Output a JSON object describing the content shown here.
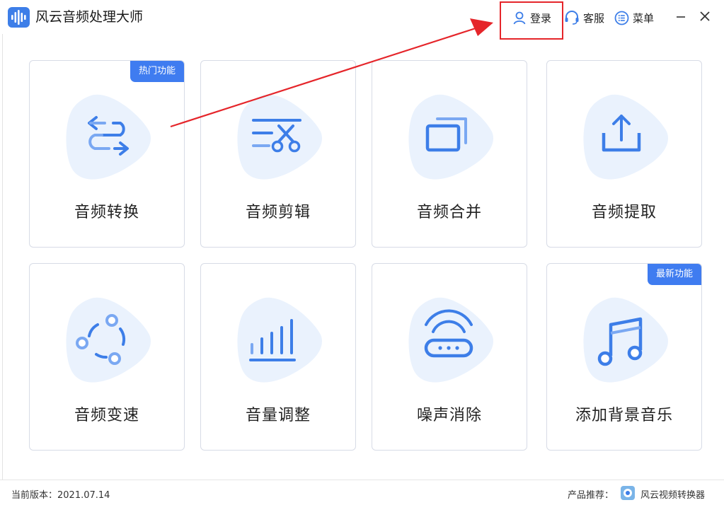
{
  "app": {
    "title": "风云音频处理大师",
    "logo_icon": "audio-wave-icon"
  },
  "titlebar": {
    "login_label": "登录",
    "login_icon": "user-icon",
    "service_label": "客服",
    "service_icon": "headset-icon",
    "menu_label": "菜单",
    "menu_icon": "list-icon",
    "minimize_icon": "minimize-icon",
    "close_icon": "close-icon"
  },
  "features": [
    {
      "label": "音频转换",
      "icon": "convert-arrows-icon",
      "badge": "热门功能"
    },
    {
      "label": "音频剪辑",
      "icon": "scissors-icon",
      "badge": ""
    },
    {
      "label": "音频合并",
      "icon": "merge-windows-icon",
      "badge": ""
    },
    {
      "label": "音频提取",
      "icon": "upload-tray-icon",
      "badge": ""
    },
    {
      "label": "音频变速",
      "icon": "speed-circle-icon",
      "badge": ""
    },
    {
      "label": "音量调整",
      "icon": "volume-bars-icon",
      "badge": ""
    },
    {
      "label": "噪声消除",
      "icon": "router-wifi-icon",
      "badge": ""
    },
    {
      "label": "添加背景音乐",
      "icon": "music-note-icon",
      "badge": "最新功能"
    }
  ],
  "footer": {
    "version_text": "当前版本：2021.07.14",
    "recommend_label": "产品推荐：",
    "recommend_icon": "video-converter-icon",
    "recommend_product": "风云视频转换器"
  },
  "colors": {
    "accent": "#3f7cf0",
    "icon_blue": "#3d7ee8",
    "icon_light": "#7aa8f2",
    "blob": "#eaf2fd",
    "highlight_red": "#e5252a"
  }
}
